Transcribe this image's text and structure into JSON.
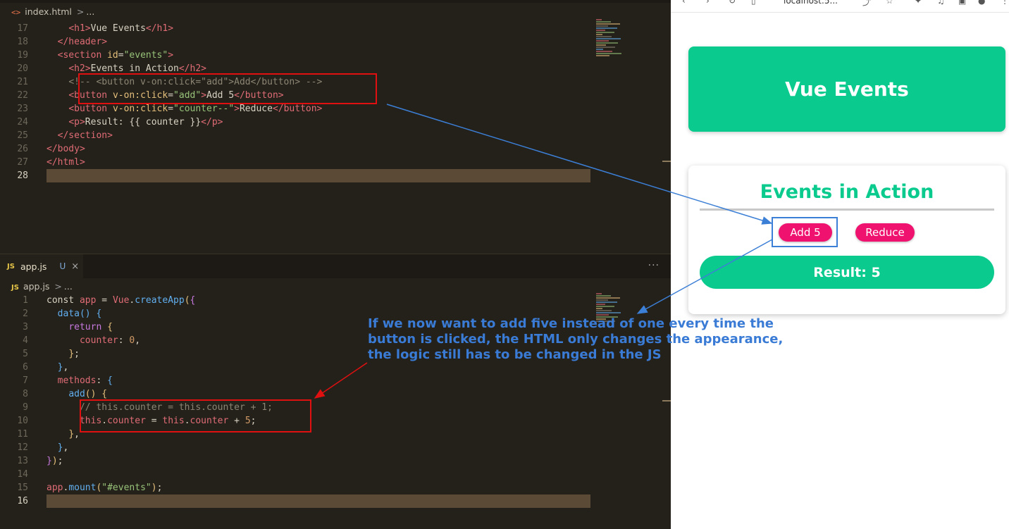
{
  "editor": {
    "top_pane": {
      "breadcrumb": {
        "icon": "html-file-icon",
        "file": "index.html",
        "sep": ">",
        "rest": "..."
      },
      "lines": [
        {
          "n": "17",
          "html": "    <span class='tag'>&lt;h1</span><span class='tag'>&gt;</span>Vue Events<span class='tag'>&lt;/h1&gt;</span>"
        },
        {
          "n": "18",
          "html": "  <span class='tag'>&lt;/header&gt;</span>"
        },
        {
          "n": "19",
          "html": "  <span class='tag'>&lt;section</span> <span class='attr'>id</span>=<span class='str'>\"events\"</span><span class='tag'>&gt;</span>"
        },
        {
          "n": "20",
          "html": "    <span class='tag'>&lt;h2&gt;</span>Events in Action<span class='tag'>&lt;/h2&gt;</span>"
        },
        {
          "n": "21",
          "html": "    <span class='cm'>&lt;!-- &lt;button v-on:click=\"add\"&gt;Add&lt;/button&gt; --&gt;</span>"
        },
        {
          "n": "22",
          "html": "    <span class='tag'>&lt;button</span> <span class='attr'>v-on:click</span>=<span class='str'>\"add\"</span><span class='tag'>&gt;</span>Add 5<span class='tag'>&lt;/button&gt;</span>"
        },
        {
          "n": "23",
          "html": "    <span class='tag'>&lt;button</span> <span class='attr'>v-on:click</span>=<span class='str'>\"counter--\"</span><span class='tag'>&gt;</span>Reduce<span class='tag'>&lt;/button&gt;</span>"
        },
        {
          "n": "24",
          "html": "    <span class='tag'>&lt;p&gt;</span>Result: {{ counter }}<span class='tag'>&lt;/p&gt;</span>"
        },
        {
          "n": "25",
          "html": "  <span class='tag'>&lt;/section&gt;</span>"
        },
        {
          "n": "26",
          "html": "<span class='tag'>&lt;/body&gt;</span>"
        },
        {
          "n": "27",
          "html": "<span class='tag'>&lt;/html&gt;</span>"
        },
        {
          "n": "28",
          "html": ""
        }
      ]
    },
    "bottom_pane": {
      "tab": {
        "icon": "JS",
        "name": "app.js",
        "status": "U",
        "close": "×"
      },
      "more": "···",
      "breadcrumb": {
        "icon": "JS",
        "file": "app.js",
        "sep": ">",
        "rest": "..."
      },
      "lines": [
        {
          "n": "1",
          "html": "<span class='pl'>const</span> <span class='tag'>app</span> = <span class='tag'>Vue</span>.<span class='fn'>createApp</span><span class='br1'>(</span><span class='br2'>{</span>"
        },
        {
          "n": "2",
          "html": "  <span class='fn'>data</span><span class='br3'>()</span> <span class='br3'>{</span>"
        },
        {
          "n": "3",
          "html": "    <span class='kw'>return</span> <span class='br1'>{</span>"
        },
        {
          "n": "4",
          "html": "      <span class='tag'>counter</span>: <span class='num'>0</span>,"
        },
        {
          "n": "5",
          "html": "    <span class='br1'>}</span>;"
        },
        {
          "n": "6",
          "html": "  <span class='br3'>}</span>,"
        },
        {
          "n": "7",
          "html": "  <span class='tag'>methods</span>: <span class='br3'>{</span>"
        },
        {
          "n": "8",
          "html": "    <span class='fn'>add</span><span class='br1'>()</span> <span class='br1'>{</span>"
        },
        {
          "n": "9",
          "html": "      <span class='cm'>// this.counter = this.counter + 1;</span>"
        },
        {
          "n": "10",
          "html": "      <span class='tag'>this</span>.<span class='tag'>counter</span> = <span class='tag'>this</span>.<span class='tag'>counter</span> + <span class='num'>5</span>;"
        },
        {
          "n": "11",
          "html": "    <span class='br1'>}</span>,"
        },
        {
          "n": "12",
          "html": "  <span class='br3'>}</span>,"
        },
        {
          "n": "13",
          "html": "<span class='br2'>}</span><span class='br1'>)</span>;"
        },
        {
          "n": "14",
          "html": ""
        },
        {
          "n": "15",
          "html": "<span class='tag'>app</span>.<span class='fn'>mount</span><span class='br1'>(</span><span class='str'>\"#events\"</span><span class='br1'>)</span>;"
        },
        {
          "n": "16",
          "html": ""
        }
      ]
    }
  },
  "browser": {
    "url": "localhost:5...",
    "header_title": "Vue Events",
    "section_title": "Events in Action",
    "add_button": "Add 5",
    "reduce_button": "Reduce",
    "result": "Result: 5"
  },
  "annotation": {
    "text": "If we now want to add five instead of one every time the button is clicked, the HTML only changes the appearance, the logic still has to be changed in the JS",
    "color": "#3a7bd5"
  },
  "colors": {
    "accent_green": "#0acb8d",
    "accent_pink": "#f0126f",
    "highlight_red": "#e01010",
    "highlight_blue": "#3c7fd6"
  }
}
